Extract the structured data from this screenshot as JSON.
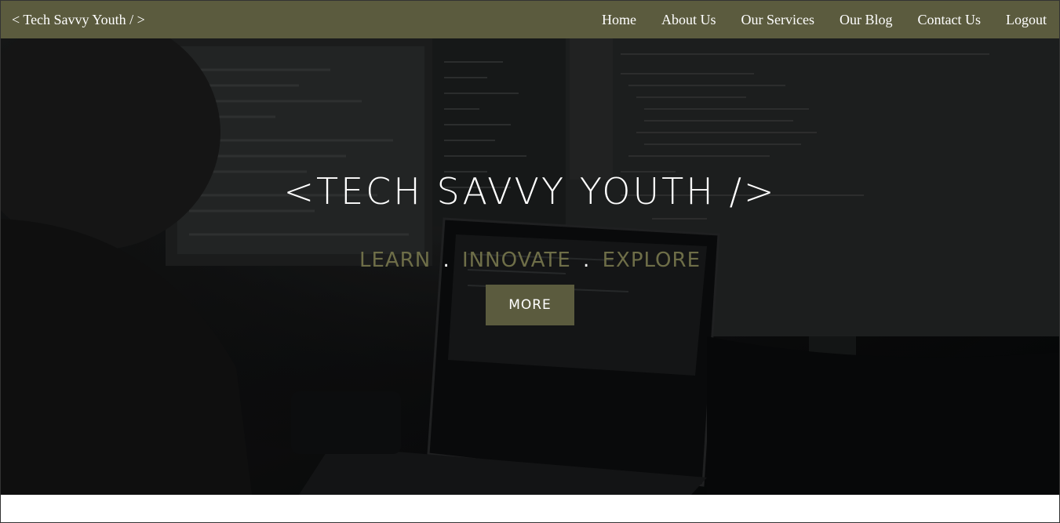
{
  "navbar": {
    "brand": "< Tech Savvy Youth / >",
    "links": [
      "Home",
      "About Us",
      "Our Services",
      "Our Blog",
      "Contact Us",
      "Logout"
    ]
  },
  "hero": {
    "title": "<Tech Savvy Youth />",
    "subtitle": {
      "part1": "Learn",
      "dot1": ".",
      "part2": "Innovate",
      "dot2": ".",
      "part3": "Explore"
    },
    "button_label": "More"
  },
  "colors": {
    "accent": "#5b5b3e",
    "subtitle": "#6e6e48",
    "hero_bg": "#0f1011"
  }
}
